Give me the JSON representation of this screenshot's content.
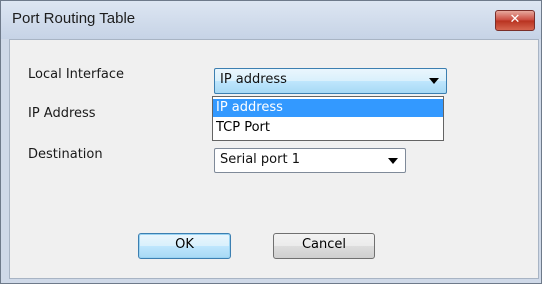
{
  "window": {
    "title": "Port Routing Table",
    "close_label": "✕"
  },
  "form": {
    "local_interface": {
      "label": "Local Interface",
      "value": "IP address"
    },
    "ip_address": {
      "label": "IP Address"
    },
    "destination": {
      "label": "Destination",
      "value": "Serial port 1"
    }
  },
  "dropdown": {
    "options": [
      "IP address",
      "TCP Port"
    ],
    "selected": "IP address"
  },
  "buttons": {
    "ok": "OK",
    "cancel": "Cancel"
  }
}
